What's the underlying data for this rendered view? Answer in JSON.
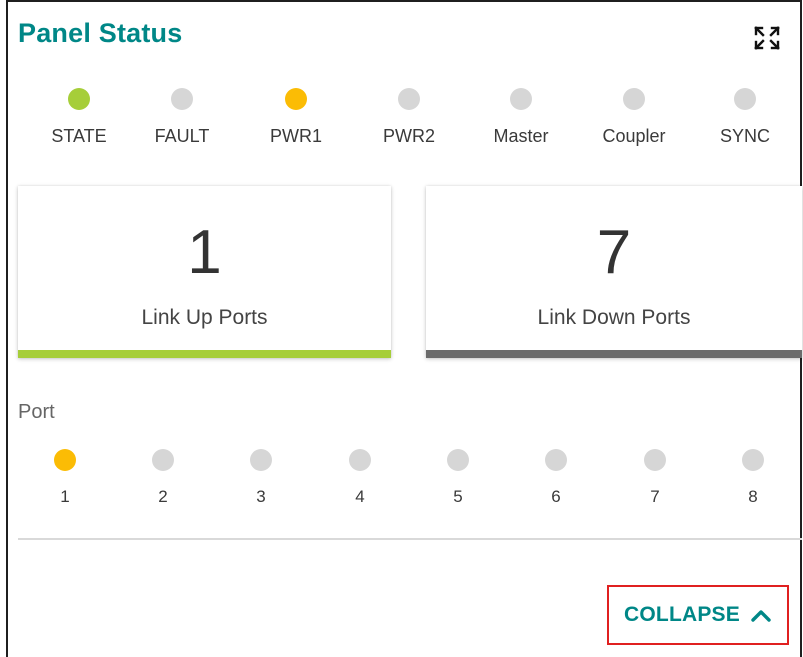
{
  "panel": {
    "title": "Panel Status"
  },
  "leds": [
    {
      "label": "STATE",
      "color": "#a6ce39"
    },
    {
      "label": "FAULT",
      "color": "#d6d6d6"
    },
    {
      "label": "PWR1",
      "color": "#fbbc05"
    },
    {
      "label": "PWR2",
      "color": "#d6d6d6"
    },
    {
      "label": "Master",
      "color": "#d6d6d6"
    },
    {
      "label": "Coupler",
      "color": "#d6d6d6"
    },
    {
      "label": "SYNC",
      "color": "#d6d6d6"
    }
  ],
  "cards": {
    "link_up": {
      "value": "1",
      "label": "Link Up Ports",
      "bar_color": "#a6ce39"
    },
    "link_down": {
      "value": "7",
      "label": "Link Down Ports",
      "bar_color": "#6b6b6b"
    }
  },
  "ports": {
    "title": "Port",
    "items": [
      {
        "label": "1",
        "color": "#fbbc05"
      },
      {
        "label": "2",
        "color": "#d6d6d6"
      },
      {
        "label": "3",
        "color": "#d6d6d6"
      },
      {
        "label": "4",
        "color": "#d6d6d6"
      },
      {
        "label": "5",
        "color": "#d6d6d6"
      },
      {
        "label": "6",
        "color": "#d6d6d6"
      },
      {
        "label": "7",
        "color": "#d6d6d6"
      },
      {
        "label": "8",
        "color": "#d6d6d6"
      }
    ]
  },
  "actions": {
    "collapse_label": "COLLAPSE",
    "collapse_icon": "chevron-up-icon",
    "expand_icon": "fullscreen-icon"
  },
  "colors": {
    "accent": "#008787",
    "highlight_border": "#e02020"
  }
}
